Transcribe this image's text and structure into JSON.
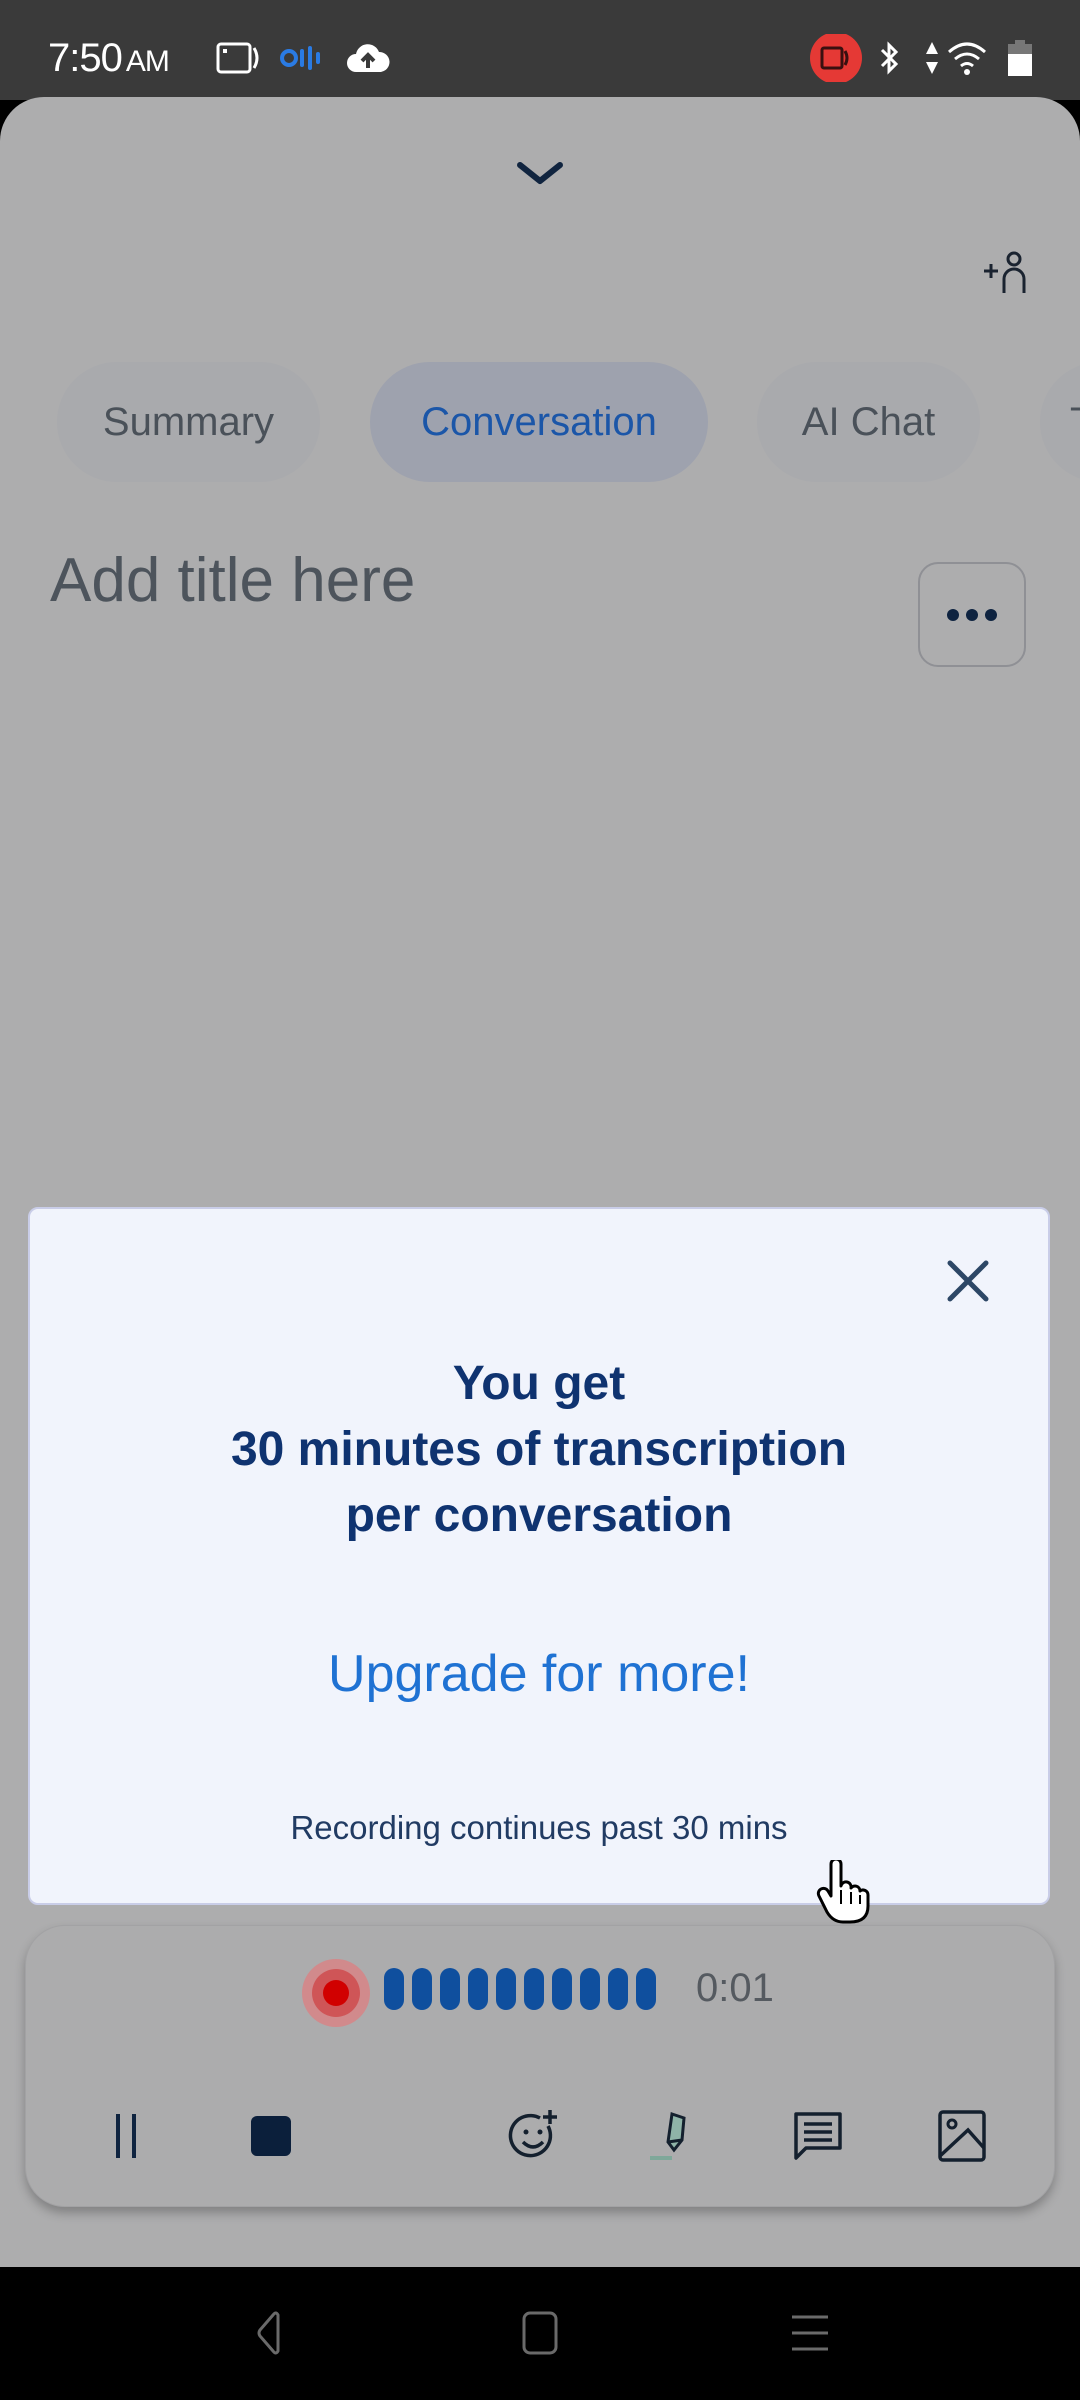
{
  "status_bar": {
    "time": "7:50",
    "ampm": "AM",
    "icons": [
      "screen-record-icon",
      "otter-app-icon",
      "cloud-upload-icon",
      "camera-recording-icon",
      "bluetooth-icon",
      "data-arrows-icon",
      "wifi-icon",
      "battery-icon"
    ]
  },
  "header": {
    "collapse_icon": "chevron-down-icon",
    "add_participant_icon": "add-person-icon"
  },
  "tabs": [
    {
      "label": "Summary",
      "active": false
    },
    {
      "label": "Conversation",
      "active": true
    },
    {
      "label": "AI Chat",
      "active": false
    },
    {
      "label": "T",
      "active": false
    }
  ],
  "title": {
    "placeholder": "Add title here",
    "more_icon": "more-horizontal-icon"
  },
  "modal": {
    "headline_line1": "You get",
    "headline_line2": "30 minutes of transcription",
    "headline_line3": "per conversation",
    "upgrade_link": "Upgrade for more!",
    "note": "Recording continues past 30 mins",
    "close_icon": "close-icon"
  },
  "recorder": {
    "elapsed": "0:01",
    "waveform_bars": 10,
    "tools": [
      {
        "name": "pause",
        "icon": "pause-icon"
      },
      {
        "name": "stop",
        "icon": "stop-icon"
      },
      {
        "name": "add-reaction",
        "icon": "add-emoji-icon"
      },
      {
        "name": "highlight",
        "icon": "highlighter-icon"
      },
      {
        "name": "comment",
        "icon": "comment-icon"
      },
      {
        "name": "add-image",
        "icon": "image-icon"
      }
    ]
  },
  "nav": {
    "back": "back-icon",
    "home": "home-icon",
    "menu": "menu-icon"
  },
  "colors": {
    "accent_blue": "#1f72d3",
    "headline_navy": "#0f3370",
    "active_tab_text": "#1b56a8",
    "record_red": "#d10000",
    "waveform_blue": "#0f4f9e"
  }
}
